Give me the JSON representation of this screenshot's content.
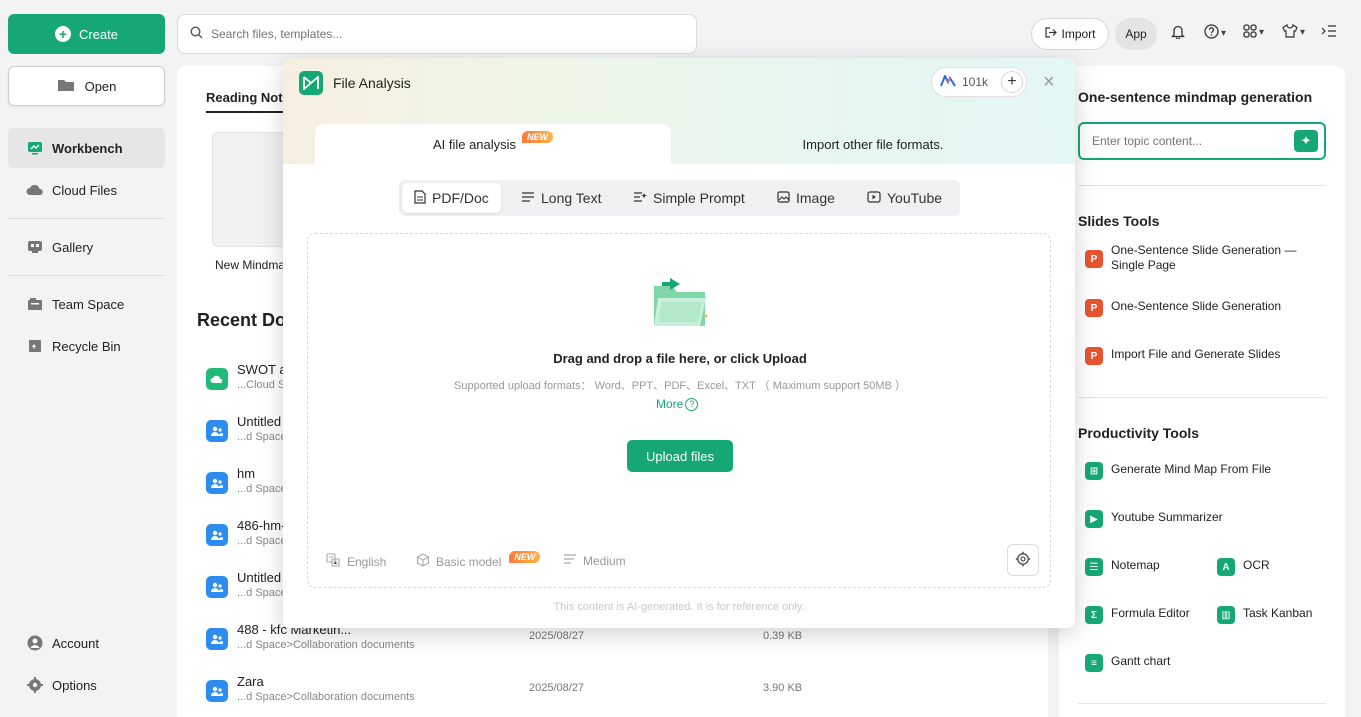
{
  "sidebar": {
    "create_label": "Create",
    "open_label": "Open",
    "items": [
      {
        "label": "Workbench"
      },
      {
        "label": "Cloud Files"
      },
      {
        "label": "Gallery"
      },
      {
        "label": "Team Space"
      },
      {
        "label": "Recycle Bin"
      }
    ],
    "bottom_items": [
      {
        "label": "Account"
      },
      {
        "label": "Options"
      }
    ]
  },
  "topbar": {
    "search_placeholder": "Search files, templates...",
    "import_label": "Import",
    "app_label": "App"
  },
  "main": {
    "tab_label": "Reading Not",
    "template_label": "New Mindma",
    "recent_title": "Recent Do",
    "documents": [
      {
        "name": "SWOT a",
        "path": "...Cloud S",
        "date": "",
        "size": "",
        "color": "#1fba7a"
      },
      {
        "name": "Untitled",
        "path": "...d Space",
        "date": "",
        "size": "",
        "color": "#2d8cf0"
      },
      {
        "name": "hm",
        "path": "...d Space",
        "date": "",
        "size": "",
        "color": "#2d8cf0"
      },
      {
        "name": "486-hm-",
        "path": "...d Space",
        "date": "",
        "size": "",
        "color": "#2d8cf0"
      },
      {
        "name": "Untitled",
        "path": "...d Space",
        "date": "",
        "size": "",
        "color": "#2d8cf0"
      },
      {
        "name": "488 - kfc Marketin...",
        "path": "...d Space>Collaboration documents",
        "date": "2025/08/27",
        "size": "0.39 KB",
        "color": "#2d8cf0"
      },
      {
        "name": "Zara",
        "path": "...d Space>Collaboration documents",
        "date": "2025/08/27",
        "size": "3.90 KB",
        "color": "#2d8cf0"
      }
    ]
  },
  "right_panel": {
    "mindmap_title": "One-sentence mindmap generation",
    "topic_placeholder": "Enter topic content...",
    "slides_title": "Slides Tools",
    "slides_tools": [
      {
        "label": "One-Sentence Slide Generation — Single Page"
      },
      {
        "label": "One-Sentence Slide Generation"
      },
      {
        "label": "Import File and Generate Slides"
      }
    ],
    "productivity_title": "Productivity Tools",
    "productivity_tools": [
      {
        "label": "Generate Mind Map From File"
      },
      {
        "label": "Youtube Summarizer"
      },
      {
        "label": "Notemap"
      },
      {
        "label": "OCR"
      },
      {
        "label": "Formula Editor"
      },
      {
        "label": "Task Kanban"
      },
      {
        "label": "Gantt chart"
      }
    ]
  },
  "modal": {
    "title": "File Analysis",
    "credits": "101k",
    "tab_active": "AI file analysis",
    "tab_badge": "NEW",
    "tab_inactive": "Import other file formats.",
    "segments": [
      {
        "label": "PDF/Doc"
      },
      {
        "label": "Long Text"
      },
      {
        "label": "Simple Prompt"
      },
      {
        "label": "Image"
      },
      {
        "label": "YouTube"
      }
    ],
    "drop_title": "Drag and drop a file here, or click Upload",
    "drop_formats": "Supported upload formats：  Word、PPT、PDF、Excel、TXT （ Maximum support 50MB ）",
    "more_label": "More",
    "upload_label": "Upload files",
    "language": "English",
    "model": "Basic model",
    "model_badge": "NEW",
    "length": "Medium",
    "disclaimer": "This content is AI-generated. It is for reference only."
  },
  "colors": {
    "accent": "#16a874",
    "doc_blue": "#2d8cf0",
    "slides_orange": "#e8542f"
  }
}
